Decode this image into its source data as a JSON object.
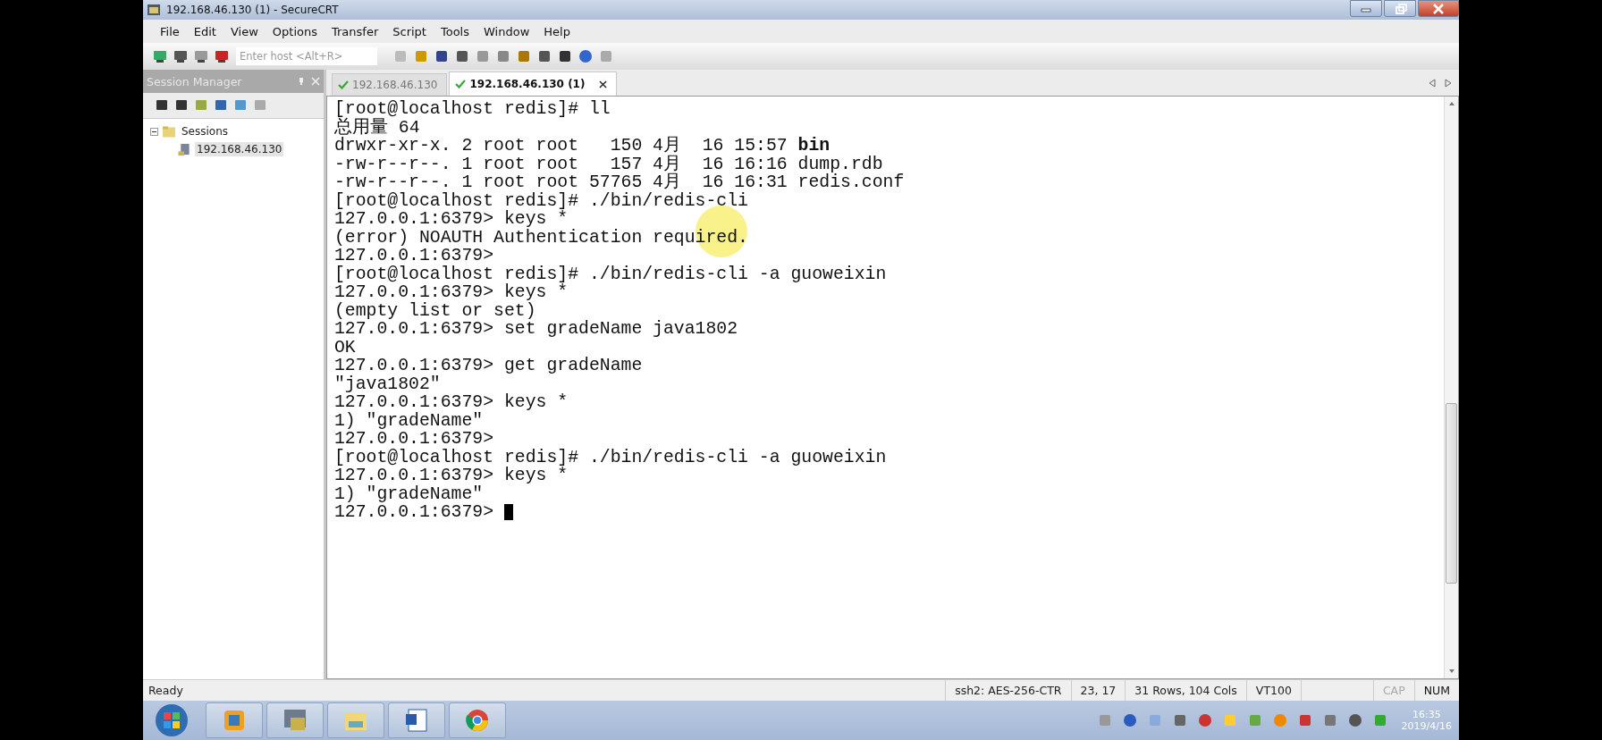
{
  "window": {
    "title": "192.168.46.130 (1) - SecureCRT"
  },
  "menu": [
    "File",
    "Edit",
    "View",
    "Options",
    "Transfer",
    "Script",
    "Tools",
    "Window",
    "Help"
  ],
  "toolbar": {
    "host_field": {
      "placeholder": "Enter host <Alt+R>"
    }
  },
  "session_manager": {
    "title": "Session Manager",
    "tree": [
      {
        "label": "Sessions",
        "expanded": true,
        "children": [
          {
            "label": "192.168.46.130",
            "selected": true
          }
        ]
      }
    ]
  },
  "tabs": [
    {
      "label": "192.168.46.130",
      "selected": false
    },
    {
      "label": "192.168.46.130 (1)",
      "selected": true
    }
  ],
  "terminal": {
    "lines": [
      "[root@localhost redis]# ll",
      "总用量 64",
      "drwxr-xr-x. 2 root root   150 4月  16 15:57 **bin**",
      "-rw-r--r--. 1 root root   157 4月  16 16:16 dump.rdb",
      "-rw-r--r--. 1 root root 57765 4月  16 16:31 redis.conf",
      "[root@localhost redis]# ./bin/redis-cli",
      "127.0.0.1:6379> keys *",
      "(error) NOAUTH Authentication required.",
      "127.0.0.1:6379>",
      "[root@localhost redis]# ./bin/redis-cli -a guoweixin",
      "127.0.0.1:6379> keys *",
      "(empty list or set)",
      "127.0.0.1:6379> set gradeName java1802",
      "OK",
      "127.0.0.1:6379> get gradeName",
      "\"java1802\"",
      "127.0.0.1:6379> keys *",
      "1) \"gradeName\"",
      "127.0.0.1:6379>",
      "[root@localhost redis]# ./bin/redis-cli -a guoweixin",
      "127.0.0.1:6379> keys *",
      "1) \"gradeName\"",
      "127.0.0.1:6379> "
    ]
  },
  "status_bar": {
    "message": "Ready",
    "fields": [
      "ssh2: AES-256-CTR",
      "23,  17",
      "31 Rows, 104 Cols",
      "VT100"
    ],
    "indicators": [
      {
        "label": "CAP",
        "on": false
      },
      {
        "label": "NUM",
        "on": true
      }
    ]
  },
  "taskbar": {
    "clock": {
      "time": "16:35",
      "date": "2019/4/16"
    }
  }
}
